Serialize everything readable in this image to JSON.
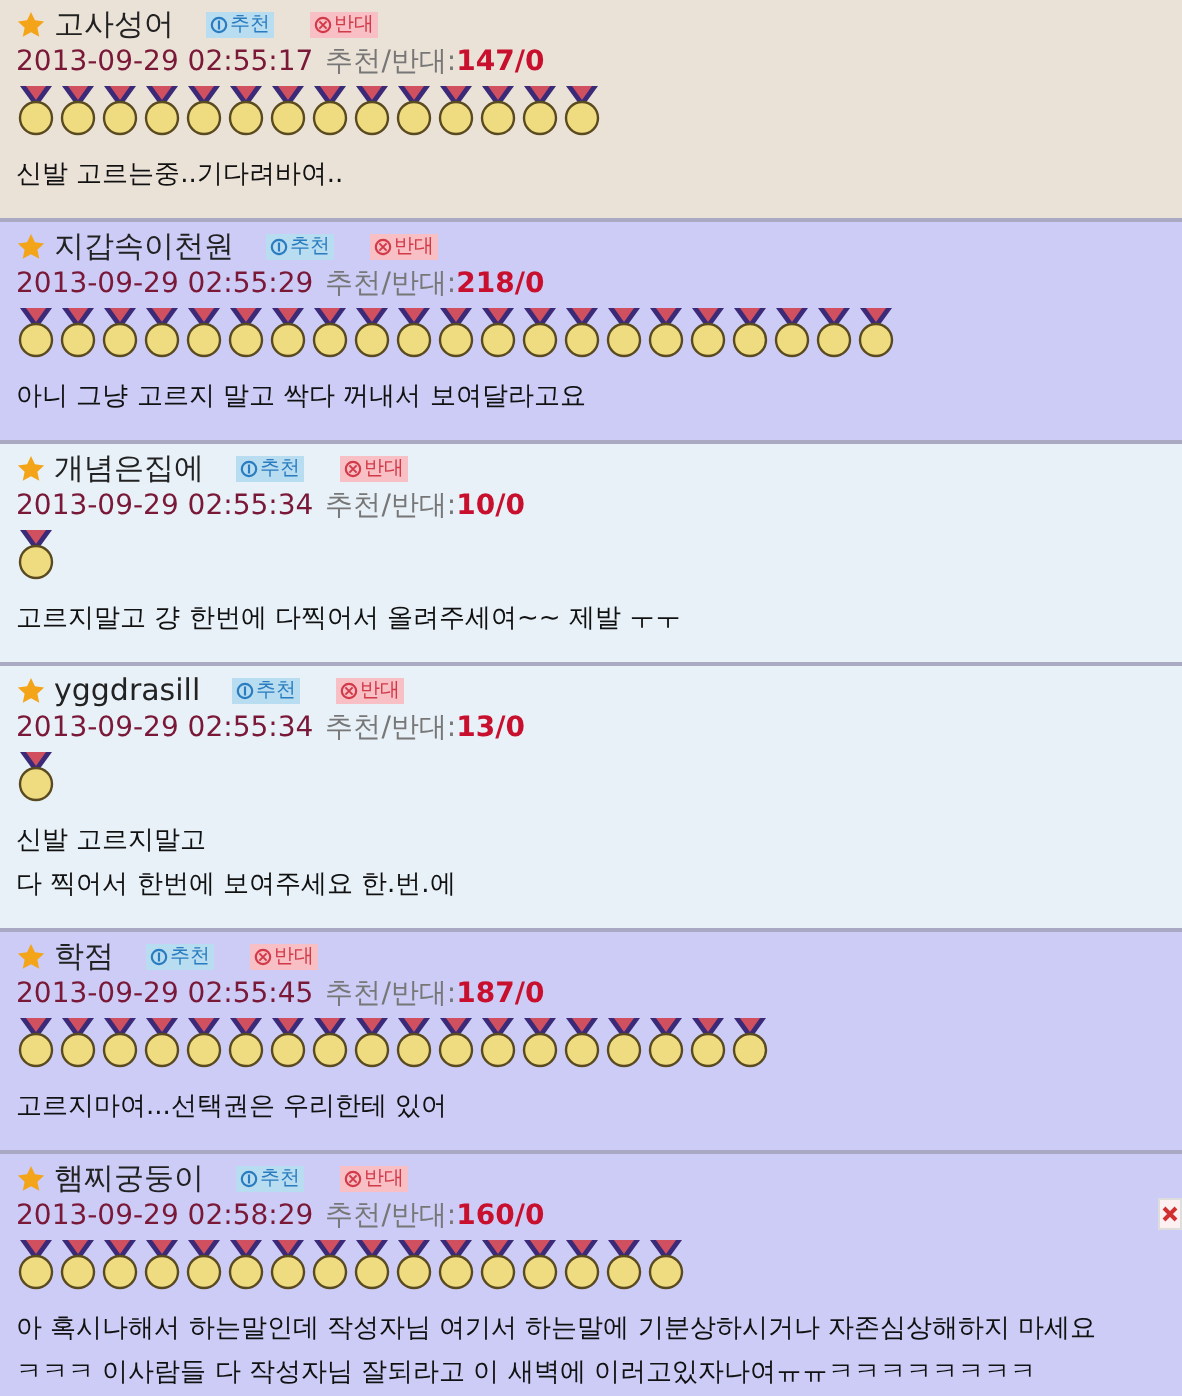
{
  "comments": [
    {
      "author": "고사성어",
      "recommend_label": "추천",
      "oppose_label": "반대",
      "date": "2013-09-29 02:55:17",
      "vote_label": "추천/반대:",
      "votes": "147/0",
      "medals": [
        {
          "kind": "gold"
        },
        {
          "kind": "gold"
        },
        {
          "kind": "gold"
        },
        {
          "kind": "gold"
        },
        {
          "kind": "gold"
        },
        {
          "kind": "gold"
        },
        {
          "kind": "gold"
        },
        {
          "kind": "gold"
        },
        {
          "kind": "gold"
        },
        {
          "kind": "gold"
        },
        {
          "kind": "gold"
        },
        {
          "kind": "gold"
        },
        {
          "kind": "gold"
        },
        {
          "kind": "gold"
        }
      ],
      "color": "#ebe2d7",
      "lines": [
        "신발 고르는중..기다려바여.."
      ],
      "closable": false
    },
    {
      "author": "지갑속이천원",
      "recommend_label": "추천",
      "oppose_label": "반대",
      "date": "2013-09-29 02:55:29",
      "vote_label": "추천/반대:",
      "votes": "218/0",
      "medals": [
        {
          "kind": "gold"
        },
        {
          "kind": "gold"
        },
        {
          "kind": "gold"
        },
        {
          "kind": "gold"
        },
        {
          "kind": "gold"
        },
        {
          "kind": "gold"
        },
        {
          "kind": "gold"
        },
        {
          "kind": "gold"
        },
        {
          "kind": "gold"
        },
        {
          "kind": "gold"
        },
        {
          "kind": "gold"
        },
        {
          "kind": "gold"
        },
        {
          "kind": "gold"
        },
        {
          "kind": "gold"
        },
        {
          "kind": "gold"
        },
        {
          "kind": "gold"
        },
        {
          "kind": "gold"
        },
        {
          "kind": "gold"
        },
        {
          "kind": "gold"
        },
        {
          "kind": "gold"
        },
        {
          "kind": "gold"
        }
      ],
      "color": "#ccccf6",
      "lines": [
        "아니 그냥 고르지 말고 싹다 꺼내서 보여달라고요"
      ],
      "closable": false
    },
    {
      "author": "개념은집에",
      "recommend_label": "추천",
      "oppose_label": "반대",
      "date": "2013-09-29 02:55:34",
      "vote_label": "추천/반대:",
      "votes": "10/0",
      "medals": [
        {
          "kind": "gold"
        }
      ],
      "color": "#e8f1f8",
      "lines": [
        "고르지말고 걍 한번에 다찍어서 올려주세여~~ 제발 ㅜㅜ"
      ],
      "closable": false
    },
    {
      "author": "yggdrasill",
      "recommend_label": "추천",
      "oppose_label": "반대",
      "date": "2013-09-29 02:55:34",
      "vote_label": "추천/반대:",
      "votes": "13/0",
      "medals": [
        {
          "kind": "gold"
        }
      ],
      "color": "#e8f1f8",
      "lines": [
        "신발 고르지말고",
        "다 찍어서 한번에 보여주세요 한.번.에"
      ],
      "closable": false
    },
    {
      "author": "학점",
      "recommend_label": "추천",
      "oppose_label": "반대",
      "date": "2013-09-29 02:55:45",
      "vote_label": "추천/반대:",
      "votes": "187/0",
      "medals": [
        {
          "kind": "gold"
        },
        {
          "kind": "gold"
        },
        {
          "kind": "gold"
        },
        {
          "kind": "gold"
        },
        {
          "kind": "gold"
        },
        {
          "kind": "gold"
        },
        {
          "kind": "gold"
        },
        {
          "kind": "gold"
        },
        {
          "kind": "gold"
        },
        {
          "kind": "gold"
        },
        {
          "kind": "gold"
        },
        {
          "kind": "gold"
        },
        {
          "kind": "gold"
        },
        {
          "kind": "gold"
        },
        {
          "kind": "gold"
        },
        {
          "kind": "gold"
        },
        {
          "kind": "gold"
        },
        {
          "kind": "gold"
        }
      ],
      "color": "#ccccf6",
      "lines": [
        "고르지마여...선택권은 우리한테 있어"
      ],
      "closable": false
    },
    {
      "author": "햄찌궁둥이",
      "recommend_label": "추천",
      "oppose_label": "반대",
      "date": "2013-09-29 02:58:29",
      "vote_label": "추천/반대:",
      "votes": "160/0",
      "medals": [
        {
          "kind": "gold"
        },
        {
          "kind": "gold"
        },
        {
          "kind": "gold"
        },
        {
          "kind": "gold"
        },
        {
          "kind": "gold"
        },
        {
          "kind": "gold"
        },
        {
          "kind": "gold"
        },
        {
          "kind": "gold"
        },
        {
          "kind": "gold"
        },
        {
          "kind": "gold"
        },
        {
          "kind": "gold"
        },
        {
          "kind": "gold"
        },
        {
          "kind": "gold"
        },
        {
          "kind": "gold"
        },
        {
          "kind": "gold"
        },
        {
          "kind": "gold"
        }
      ],
      "color": "#ccccf6",
      "lines": [
        "아 혹시나해서 하는말인데 작성자님 여기서 하는말에 기분상하시거나 자존심상해하지 마세요",
        "ㅋㅋㅋ 이사람들 다 작성자님 잘되라고 이 새벽에 이러고있자나여ㅠㅠㅋㅋㅋㅋㅋㅋㅋㅋ"
      ],
      "closable": true
    }
  ]
}
